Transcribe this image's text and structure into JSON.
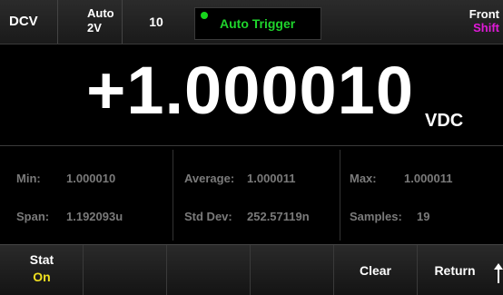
{
  "status": {
    "mode": "DCV",
    "range_mode": "Auto",
    "range_value": "2V",
    "digits": "10",
    "trigger": "Auto Trigger",
    "panel": "Front",
    "shift": "Shift",
    "colors": {
      "trigger_dot": "#17d51c",
      "trigger_text": "#1fd42c",
      "shift": "#e01ad8"
    }
  },
  "reading": {
    "value": "+1.000010",
    "unit": "VDC"
  },
  "stats": {
    "min_label": "Min:",
    "min_value": "1.000010",
    "span_label": "Span:",
    "span_value": "1.192093u",
    "average_label": "Average:",
    "average_value": "1.000011",
    "stddev_label": "Std Dev:",
    "stddev_value": "252.57119n",
    "max_label": "Max:",
    "max_value": "1.000011",
    "samples_label": "Samples:",
    "samples_value": "19"
  },
  "softkeys": {
    "stat_label": "Stat",
    "stat_state": "On",
    "stat_state_color": "#f0e020",
    "clear_label": "Clear",
    "return_label": "Return",
    "return_icon": "up-arrow-icon"
  }
}
